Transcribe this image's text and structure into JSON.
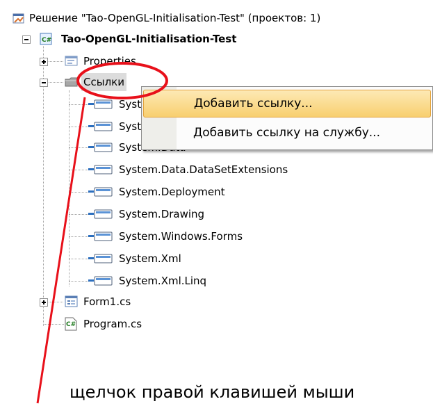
{
  "solution": {
    "title": "Решение \"Tao-OpenGL-Initialisation-Test\" (проектов: 1)"
  },
  "project": {
    "name": "Tao-OpenGL-Initialisation-Test"
  },
  "tree": {
    "properties": "Properties",
    "references": "Ссылки",
    "reference_items": [
      "System",
      "System.Core",
      "System.Data",
      "System.Data.DataSetExtensions",
      "System.Deployment",
      "System.Drawing",
      "System.Windows.Forms",
      "System.Xml",
      "System.Xml.Linq"
    ],
    "form": "Form1.cs",
    "program": "Program.cs"
  },
  "context_menu": {
    "items": [
      "Добавить ссылку...",
      "Добавить ссылку на службу..."
    ]
  },
  "annotation": {
    "caption": "щелчок правой клавишей мыши"
  },
  "colors": {
    "annotation": "#e8101a",
    "highlight": "#f8cf6f"
  }
}
